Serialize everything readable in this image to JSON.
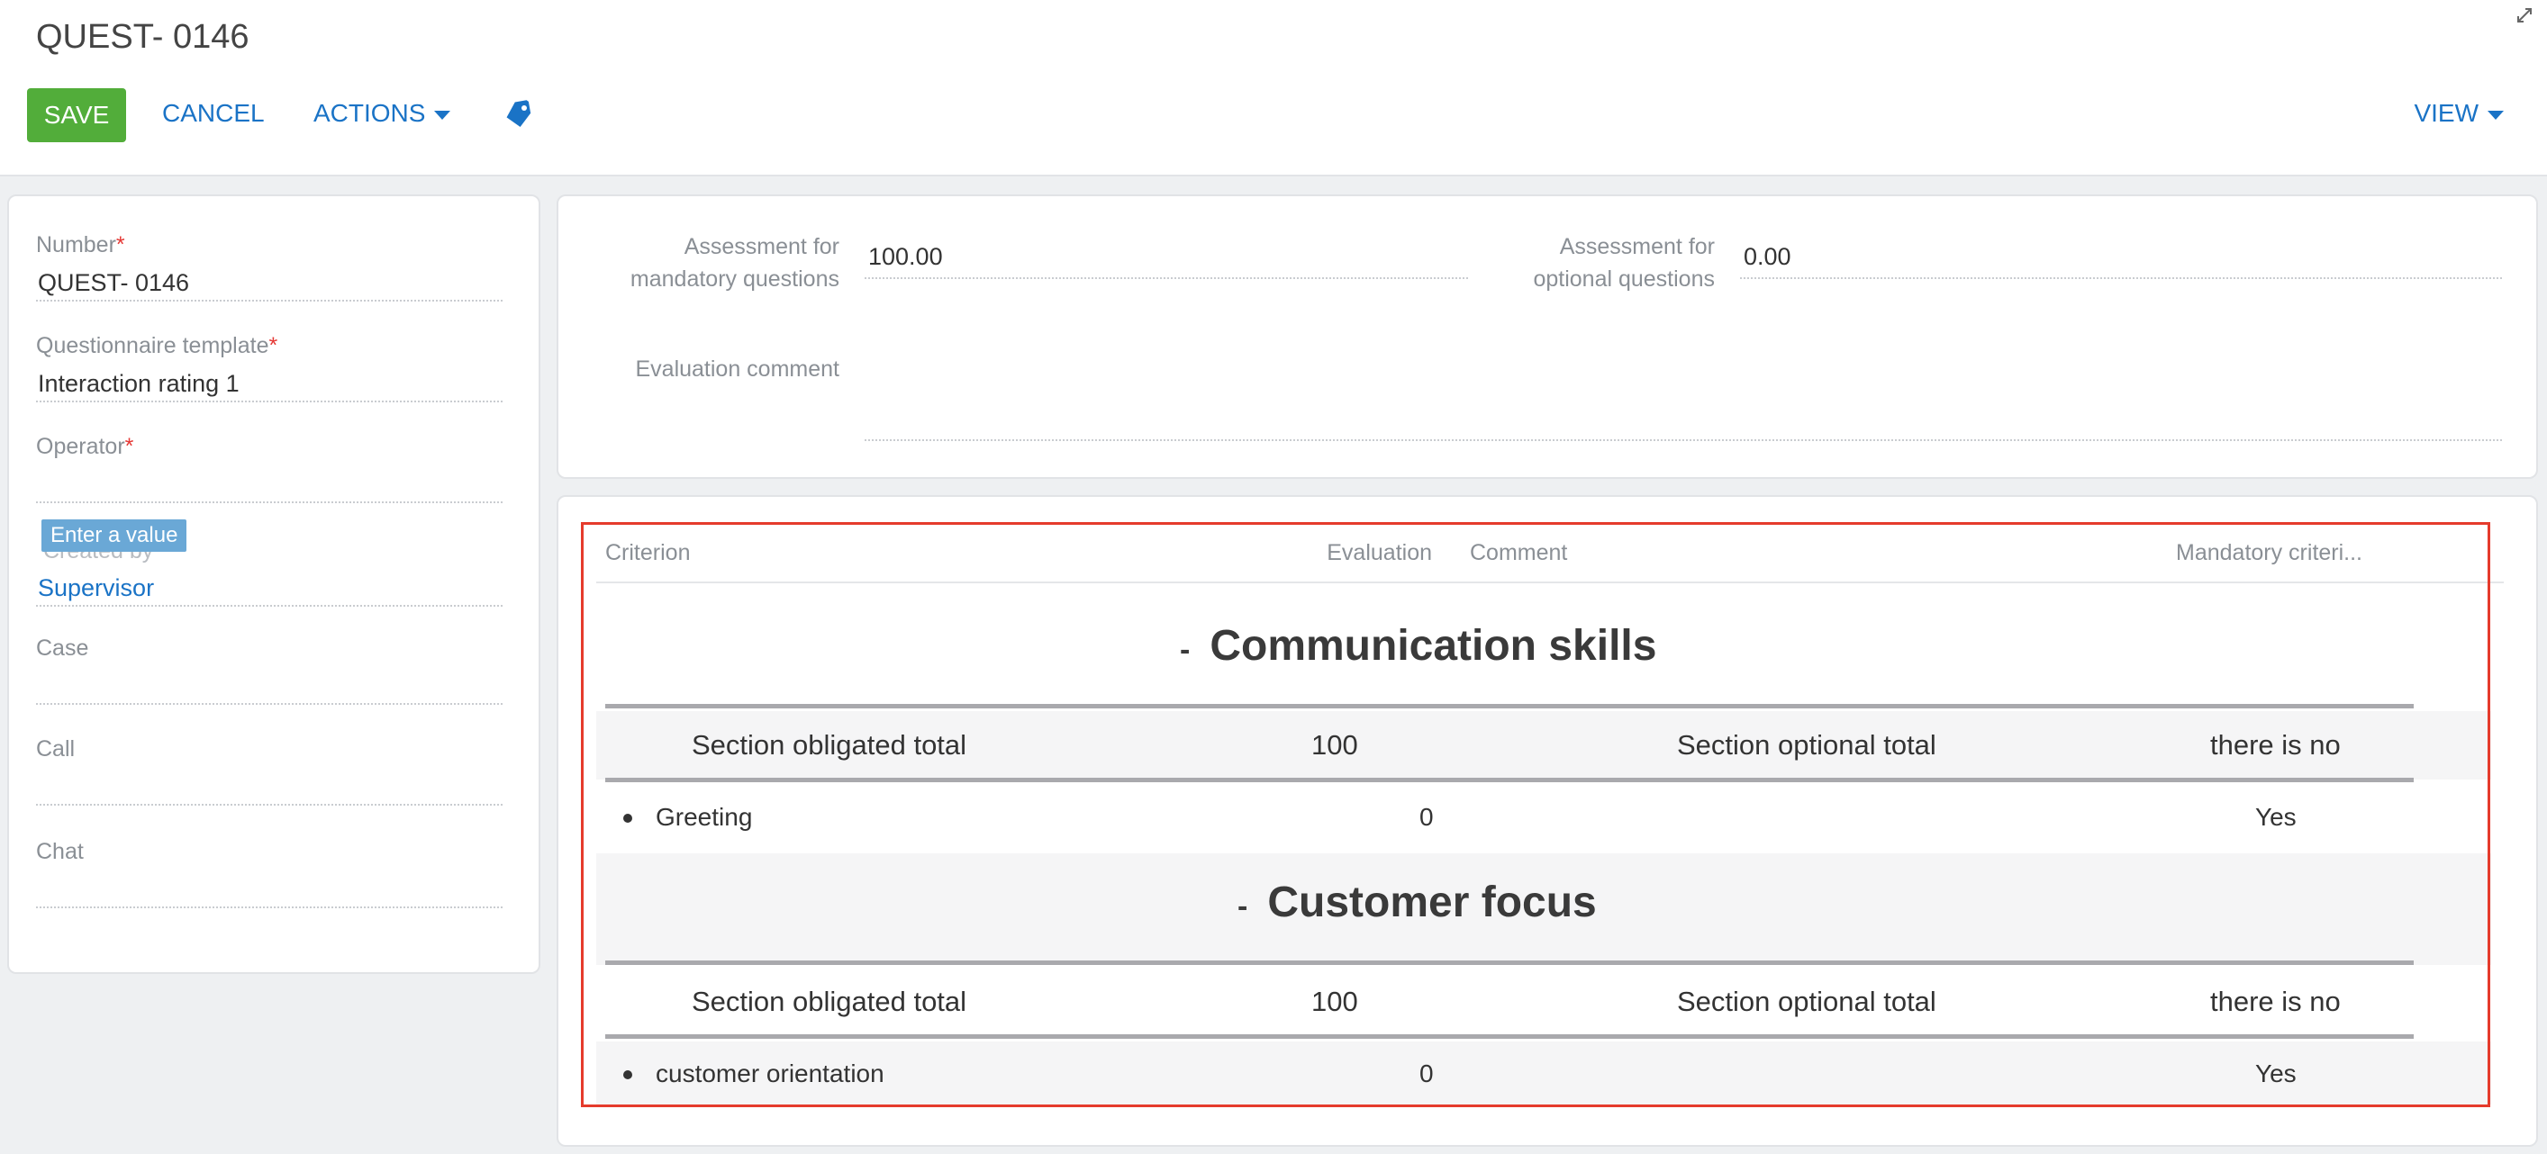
{
  "header": {
    "title": "QUEST- 0146",
    "save_label": "SAVE",
    "cancel_label": "CANCEL",
    "actions_label": "ACTIONS",
    "view_label": "VIEW"
  },
  "left_panel": {
    "number": {
      "label": "Number",
      "value": "QUEST- 0146",
      "required": "*"
    },
    "template": {
      "label": "Questionnaire template",
      "value": "Interaction rating 1",
      "required": "*"
    },
    "operator": {
      "label": "Operator",
      "value": "",
      "required": "*"
    },
    "tooltip": "Enter a value",
    "created_by": {
      "label": "Created by",
      "value": "Supervisor"
    },
    "case": {
      "label": "Case",
      "value": ""
    },
    "call": {
      "label": "Call",
      "value": ""
    },
    "chat": {
      "label": "Chat",
      "value": ""
    }
  },
  "assessment": {
    "mandatory_label_1": "Assessment for",
    "mandatory_label_2": "mandatory questions",
    "mandatory_value": "100.00",
    "optional_label_1": "Assessment for",
    "optional_label_2": "optional questions",
    "optional_value": "0.00",
    "comment_label": "Evaluation comment",
    "comment_value": ""
  },
  "criteria_table": {
    "columns": {
      "criterion": "Criterion",
      "evaluation": "Evaluation",
      "comment": "Comment",
      "mandatory": "Mandatory criteri..."
    },
    "sections": [
      {
        "title": "Communication skills",
        "collapse_symbol": "-",
        "obligated_label": "Section obligated total",
        "obligated_value": "100",
        "optional_label": "Section optional total",
        "optional_value": "there is no",
        "item": {
          "name": "Greeting",
          "evaluation": "0",
          "mandatory": "Yes"
        }
      },
      {
        "title": "Customer focus",
        "collapse_symbol": "-",
        "obligated_label": "Section obligated total",
        "obligated_value": "100",
        "optional_label": "Section optional total",
        "optional_value": "there is no",
        "item": {
          "name": "customer orientation",
          "evaluation": "0",
          "mandatory": "Yes"
        }
      }
    ]
  },
  "colors": {
    "accent": "#1a73c6",
    "save": "#52ad3a",
    "highlight_frame": "#e53b2c",
    "required": "#e53935"
  },
  "icons": [
    "tag-icon",
    "expand-icon",
    "caret-down-icon",
    "bullet-icon"
  ]
}
